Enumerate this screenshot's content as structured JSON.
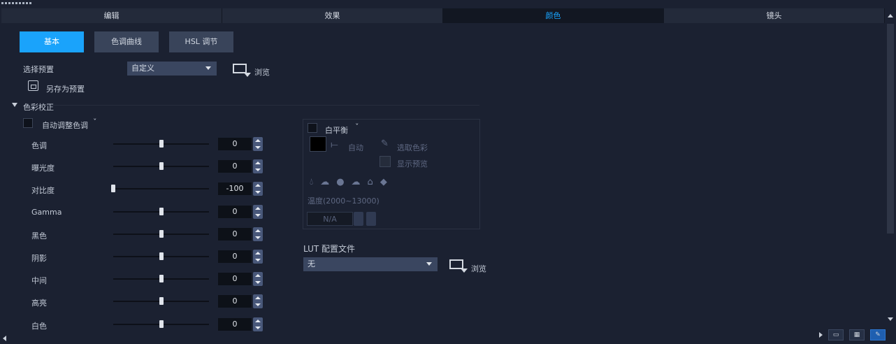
{
  "tabs": [
    {
      "label": "编辑"
    },
    {
      "label": "效果"
    },
    {
      "label": "颜色"
    },
    {
      "label": "镜头"
    }
  ],
  "subtabs": [
    {
      "label": "基本"
    },
    {
      "label": "色调曲线"
    },
    {
      "label": "HSL 调节"
    }
  ],
  "preset": {
    "label": "选择预置",
    "value": "自定义",
    "browse_label": "浏览",
    "save_as_label": "另存为预置"
  },
  "color_correction": {
    "section_label": "色彩校正",
    "auto_label": "自动调整色调",
    "sliders": [
      {
        "label": "色调",
        "value": "0",
        "position": 0.5
      },
      {
        "label": "曝光度",
        "value": "0",
        "position": 0.5
      },
      {
        "label": "对比度",
        "value": "-100",
        "position": 0.0
      },
      {
        "label": "Gamma",
        "value": "0",
        "position": 0.5
      },
      {
        "label": "黑色",
        "value": "0",
        "position": 0.5
      },
      {
        "label": "阴影",
        "value": "0",
        "position": 0.5
      },
      {
        "label": "中间",
        "value": "0",
        "position": 0.5
      },
      {
        "label": "高亮",
        "value": "0",
        "position": 0.5
      },
      {
        "label": "白色",
        "value": "0",
        "position": 0.5
      }
    ]
  },
  "white_balance": {
    "label": "白平衡",
    "auto_label": "自动",
    "pick_color_label": "选取色彩",
    "show_preview_label": "显示预览",
    "temp_label": "温度(2000~13000)",
    "temp_value": "N/A",
    "icons": [
      "drop-icon",
      "cloud-icon",
      "sun-icon",
      "overcast-icon",
      "house-icon",
      "stone-icon"
    ]
  },
  "lut": {
    "label": "LUT 配置文件",
    "value": "无",
    "browse_label": "浏览"
  },
  "colors": {
    "accent": "#1aa3fb",
    "background": "#1b2131"
  }
}
